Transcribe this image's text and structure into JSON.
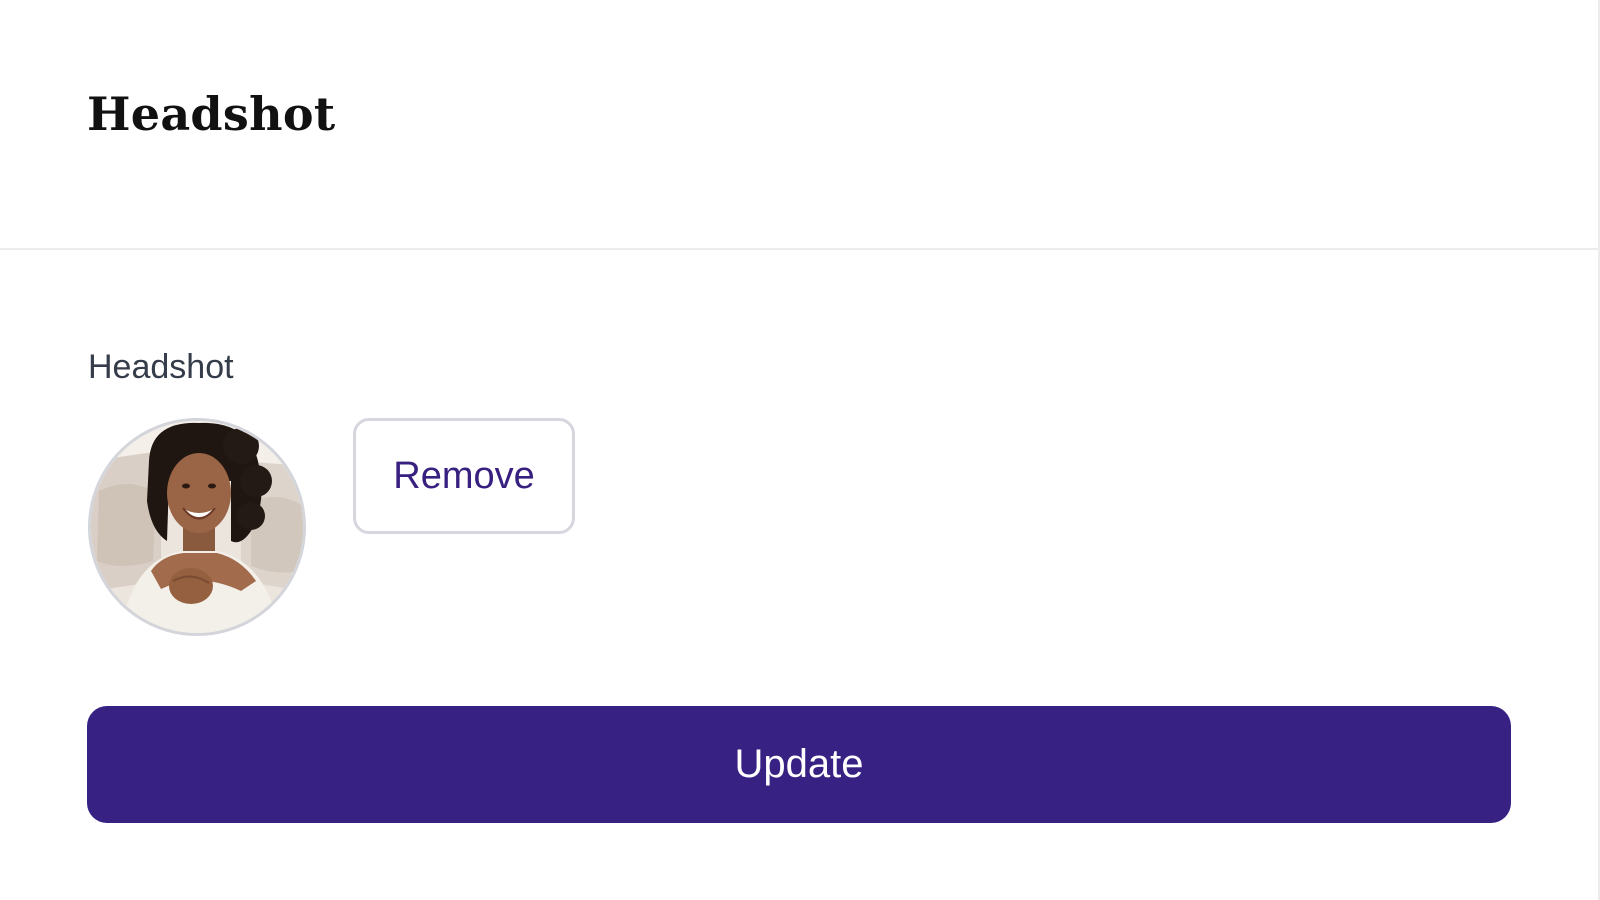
{
  "header": {
    "title": "Headshot"
  },
  "headshot_field": {
    "label": "Headshot",
    "image_alt": "Headshot",
    "remove_label": "Remove"
  },
  "actions": {
    "update_label": "Update"
  },
  "colors": {
    "primary": "#372183",
    "primary_text": "#ffffff",
    "remove_text": "#37207f",
    "divider": "#ececec"
  }
}
